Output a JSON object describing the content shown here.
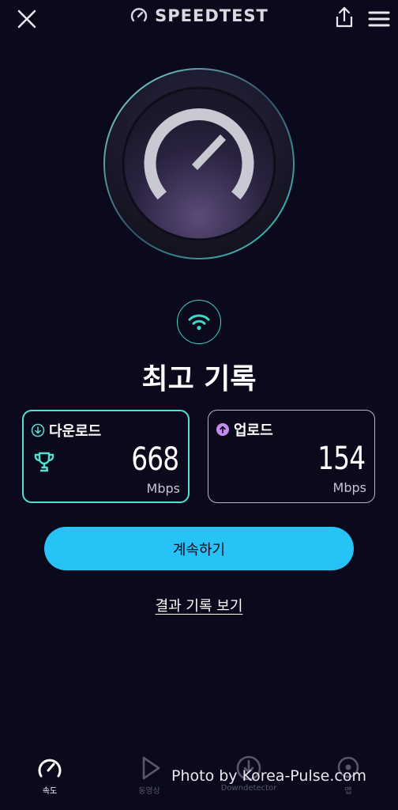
{
  "header": {
    "close_icon": "close-icon",
    "brand_icon": "gauge-icon",
    "brand_text": "SPEEDTEST",
    "share_icon": "share-icon",
    "menu_icon": "hamburger-menu-icon"
  },
  "status": {
    "wifi_icon": "wifi-icon",
    "title": "최고 기록"
  },
  "results": {
    "download": {
      "icon": "download-arrow-icon",
      "label": "다운로드",
      "value": "668",
      "unit": "Mbps",
      "badge_icon": "trophy-icon"
    },
    "upload": {
      "icon": "upload-arrow-icon",
      "label": "업로드",
      "value": "154",
      "unit": "Mbps"
    }
  },
  "actions": {
    "continue_label": "계속하기",
    "history_label": "결과 기록 보기"
  },
  "bottom_nav": {
    "items": [
      {
        "label": "속도",
        "icon": "speed-gauge-icon",
        "active": true
      },
      {
        "label": "동영상",
        "icon": "play-icon",
        "active": false
      },
      {
        "label": "Downdetector",
        "icon": "downdetector-icon",
        "active": false
      },
      {
        "label": "맵",
        "icon": "map-pin-icon",
        "active": false
      }
    ]
  },
  "watermark": "Photo by Korea-Pulse.com",
  "colors": {
    "background": "#0b0a1c",
    "accent_teal": "#56e0cf",
    "button_blue": "#27c2f6",
    "upload_purple": "#c58cf0"
  }
}
